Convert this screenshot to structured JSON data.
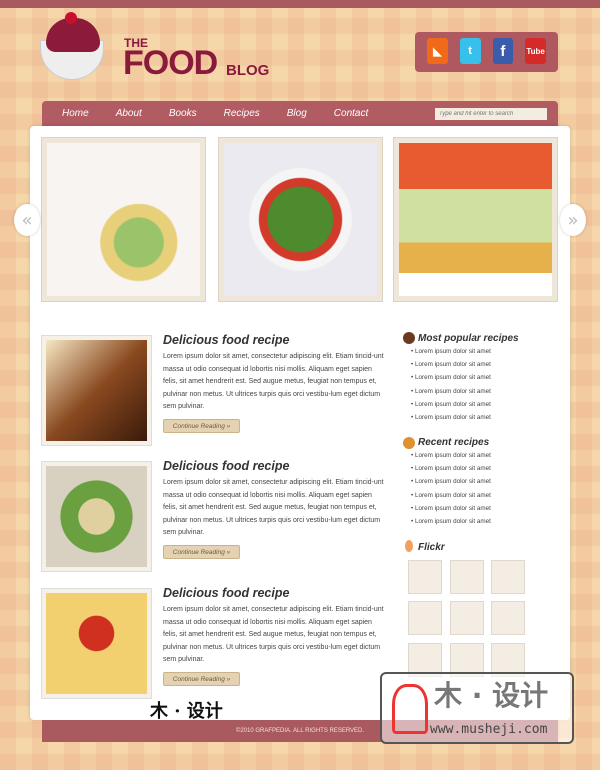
{
  "header": {
    "logo": {
      "the": "THE",
      "food": "FOOD",
      "blog": "BLOG"
    },
    "social": [
      {
        "icon": "rss-icon",
        "label": "◣",
        "color": "#f06a1a"
      },
      {
        "icon": "twitter-icon",
        "label": "t",
        "color": "#38c0ec"
      },
      {
        "icon": "facebook-icon",
        "label": "f",
        "color": "#3b5bab"
      },
      {
        "icon": "youtube-icon",
        "label": "Tube",
        "color": "#d42a2a"
      }
    ]
  },
  "nav": {
    "items": [
      "Home",
      "About",
      "Books",
      "Recipes",
      "Blog",
      "Contact"
    ],
    "search_placeholder": "Type and hit enter to search"
  },
  "slider": {
    "prev": "«",
    "next": "»"
  },
  "posts": [
    {
      "title": "Delicious food recipe",
      "text": "Lorem ipsum dolor sit amet, consectetur adipiscing elit. Etiam tincid-unt massa ut odio consequat id lobortis nisi mollis. Aliquam eget sapien felis, sit amet hendrerit est. Sed augue metus, feugiat non tempus et, pulvinar non metus. Ut ultrices turpis quis orci vestibu-lum eget dictum sem pulvinar.",
      "button": "Continue Reading »"
    },
    {
      "title": "Delicious food recipe",
      "text": "Lorem ipsum dolor sit amet, consectetur adipiscing elit. Etiam tincid-unt massa ut odio consequat id lobortis nisi mollis. Aliquam eget sapien felis, sit amet hendrerit est. Sed augue metus, feugiat non tempus et, pulvinar non metus. Ut ultrices turpis quis orci vestibu-lum eget dictum sem pulvinar.",
      "button": "Continue Reading »"
    },
    {
      "title": "Delicious food recipe",
      "text": "Lorem ipsum dolor sit amet, consectetur adipiscing elit. Etiam tincid-unt massa ut odio consequat id lobortis nisi mollis. Aliquam eget sapien felis, sit amet hendrerit est. Sed augue metus, feugiat non tempus et, pulvinar non metus. Ut ultrices turpis quis orci vestibu-lum eget dictum sem pulvinar.",
      "button": "Continue Reading »"
    }
  ],
  "sidebar": {
    "popular": {
      "title": "Most popular recipes",
      "items": [
        "Lorem ipsum dolor sit amet",
        "Lorem ipsum dolor sit amet",
        "Lorem ipsum dolor sit amet",
        "Lorem ipsum dolor sit amet",
        "Lorem ipsum dolor sit amet",
        "Lorem ipsum dolor sit amet"
      ]
    },
    "recent": {
      "title": "Recent recipes",
      "items": [
        "Lorem ipsum dolor sit amet",
        "Lorem ipsum dolor sit amet",
        "Lorem ipsum dolor sit amet",
        "Lorem ipsum dolor sit amet",
        "Lorem ipsum dolor sit amet",
        "Lorem ipsum dolor sit amet"
      ]
    },
    "flickr": {
      "title": "Flickr"
    }
  },
  "footer": {
    "copyright": "©2010 GRAFPEDIA. ALL RIGHTS RESERVED."
  },
  "watermark": {
    "text": "木 · 设计",
    "url": "www.musheji.com"
  }
}
